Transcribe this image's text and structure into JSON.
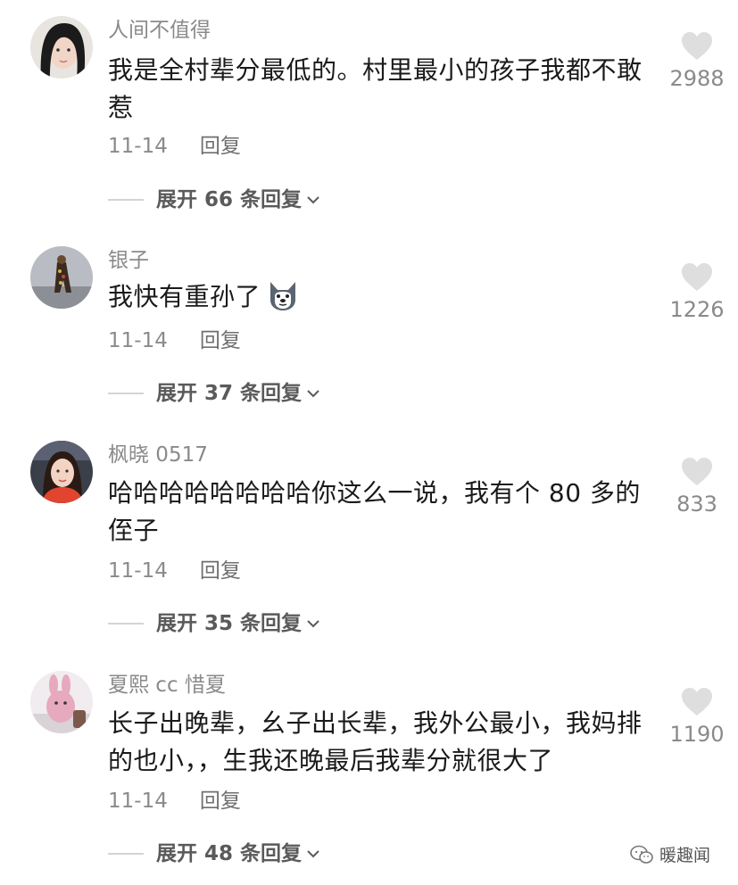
{
  "comments": [
    {
      "username": "人间不值得",
      "text": "我是全村辈分最低的。村里最小的孩子我都不敢惹",
      "date": "11-14",
      "reply_label": "回复",
      "expand_label": "展开 66 条回复",
      "likes": "2988"
    },
    {
      "username": "银子",
      "text": "我快有重孙了",
      "date": "11-14",
      "reply_label": "回复",
      "expand_label": "展开 37 条回复",
      "likes": "1226"
    },
    {
      "username": "枫晓 0517",
      "text": "哈哈哈哈哈哈哈哈你这么一说，我有个 80 多的侄子",
      "date": "11-14",
      "reply_label": "回复",
      "expand_label": "展开 35 条回复",
      "likes": "833"
    },
    {
      "username": "夏熙 cc 惜夏",
      "text": "长子出晚辈，幺子出长辈，我外公最小，我妈排的也小，，生我还晚最后我辈分就很大了",
      "date": "11-14",
      "reply_label": "回复",
      "expand_label": "展开 48 条回复",
      "likes": "1190"
    }
  ],
  "watermark": "暖趣闻",
  "icons": {
    "like": "heart-icon",
    "expand": "chevron-down-icon",
    "emoji": "husky-dog-emoji",
    "watermark": "wechat-icon"
  },
  "colors": {
    "text": "#1a1a1a",
    "muted": "#8a8a8a",
    "heart": "#dedede"
  }
}
